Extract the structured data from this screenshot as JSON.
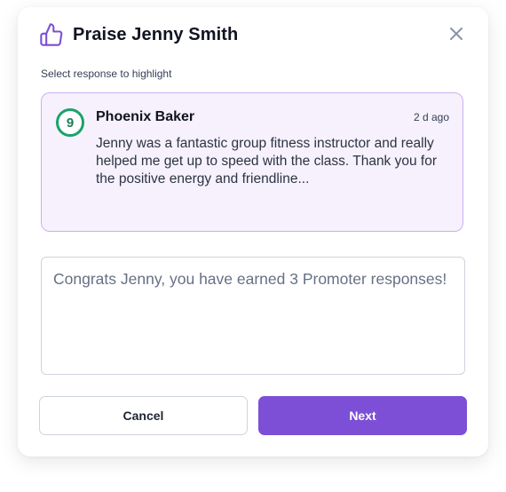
{
  "modal": {
    "title": "Praise Jenny Smith",
    "icon": "thumbs-up-icon",
    "close_icon": "close-icon"
  },
  "section_label": "Select response to highlight",
  "response": {
    "score": "9",
    "responder": "Phoenix Baker",
    "time_ago": "2 d ago",
    "text": "Jenny was a fantastic group fitness instructor and really helped me get up to speed with the class. Thank you for the positive energy and friendline..."
  },
  "message": {
    "value": "Congrats Jenny, you have earned 3 Promoter responses!"
  },
  "buttons": {
    "cancel_label": "Cancel",
    "next_label": "Next"
  },
  "colors": {
    "accent": "#7c4fd6",
    "card_background": "#f6f1fc",
    "card_border": "#c9b1f0",
    "promoter_green": "#1aa36a"
  }
}
